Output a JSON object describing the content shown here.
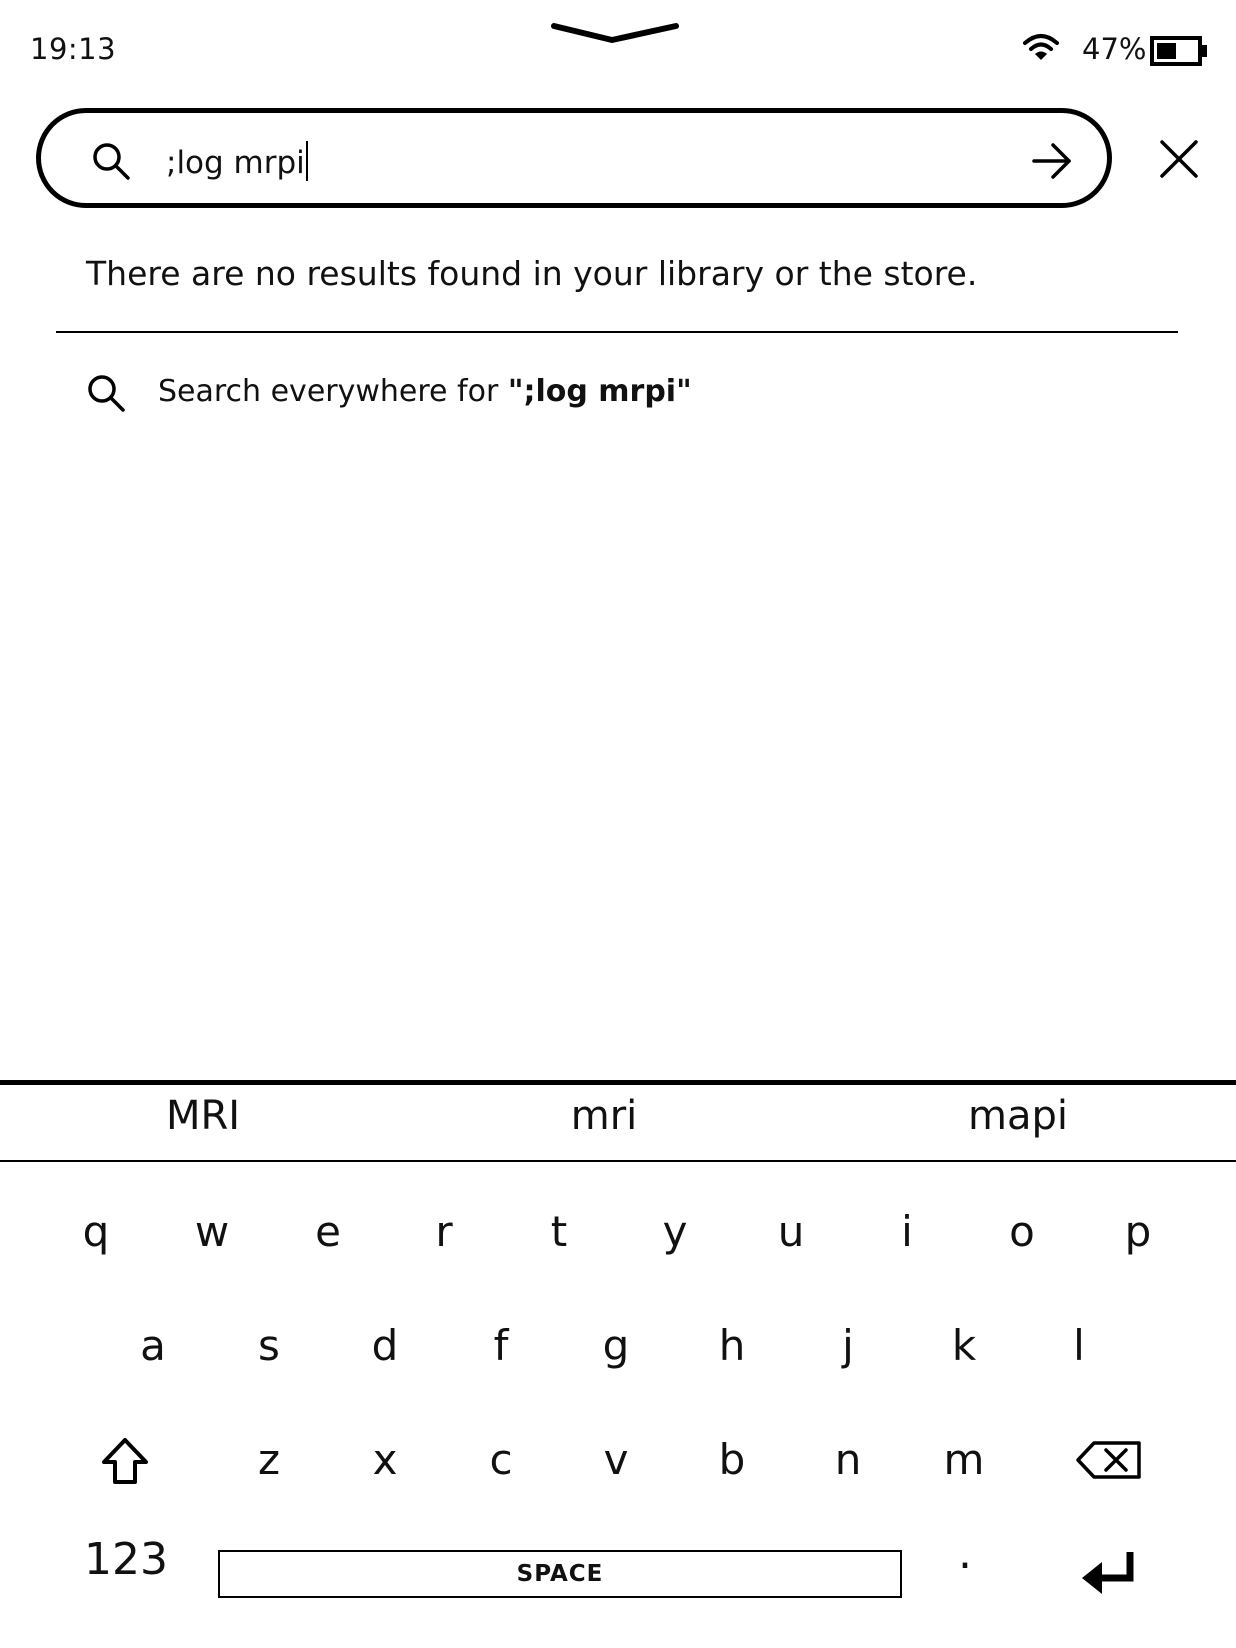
{
  "status_bar": {
    "time": "19:13",
    "battery_percent": "47%",
    "battery_level": 0.47
  },
  "search": {
    "query": ";log mrpi"
  },
  "results": {
    "message": "There are no results found in your library or the store.",
    "search_everywhere_prefix": "Search everywhere for ",
    "search_everywhere_query": "\";log mrpi\""
  },
  "keyboard": {
    "suggestions": [
      "MRI",
      "mri",
      "mapi"
    ],
    "row1": [
      "q",
      "w",
      "e",
      "r",
      "t",
      "y",
      "u",
      "i",
      "o",
      "p"
    ],
    "row2": [
      "a",
      "s",
      "d",
      "f",
      "g",
      "h",
      "j",
      "k",
      "l"
    ],
    "row3": [
      "z",
      "x",
      "c",
      "v",
      "b",
      "n",
      "m"
    ],
    "numbers_label": "123",
    "space_label": "SPACE",
    "period_label": "."
  },
  "icons": {
    "pull": "chevron-down-icon",
    "wifi": "wifi-icon",
    "battery": "battery-icon",
    "search": "search-icon",
    "submit": "arrow-right-icon",
    "close": "close-icon",
    "shift": "shift-icon",
    "backspace": "backspace-icon",
    "enter": "enter-icon"
  }
}
